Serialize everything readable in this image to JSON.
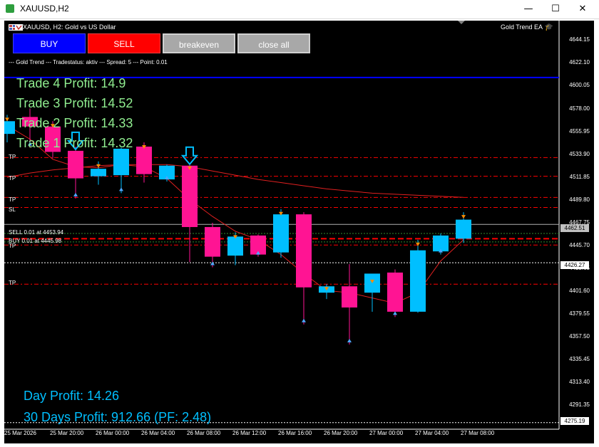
{
  "window": {
    "title": "XAUUSD,H2"
  },
  "chart": {
    "symbol_label": "XAUUSD, H2:  Gold vs US Dollar",
    "ea_label": "Gold Trend EA",
    "status_line": "--- Gold Trend --- Tradestatus: aktiv --- Spread: 5 --- Point: 0.01"
  },
  "buttons": {
    "buy": "BUY",
    "sell": "SELL",
    "breakeven": "breakeven",
    "close_all": "close all"
  },
  "trades": [
    "Trade 4 Profit: 14.9",
    "Trade 3 Profit: 14.52",
    "Trade 2 Profit: 14.33",
    "Trade 1 Profit: 14.32"
  ],
  "profits": {
    "day": "Day Profit: 14.26",
    "month": "30 Days Profit: 912.66 (PF: 2.48)"
  },
  "line_labels": {
    "tp": "TP",
    "sl": "SL",
    "sell_order": "SELL 0.01 at 4453.94",
    "buy_order": "BUY 0.01 at 4445.98"
  },
  "price_boxes": {
    "current": "4462.51",
    "lower": "4426.27",
    "bottom": "4275.19"
  },
  "y_ticks": [
    "4644.15",
    "4622.10",
    "4600.05",
    "4578.00",
    "4555.95",
    "4533.90",
    "4511.85",
    "4489.80",
    "4467.75",
    "4445.70",
    "4423.65",
    "4401.60",
    "4379.55",
    "4357.50",
    "4335.45",
    "4313.40",
    "4291.35"
  ],
  "x_ticks": [
    "25 Mar 2026",
    "25 Mar 20:00",
    "26 Mar 00:00",
    "26 Mar 04:00",
    "26 Mar 08:00",
    "26 Mar 12:00",
    "26 Mar 16:00",
    "26 Mar 20:00",
    "27 Mar 00:00",
    "27 Mar 04:00",
    "27 Mar 08:00"
  ],
  "colors": {
    "bull": "#00bfff",
    "bear": "#ff1493",
    "blue_line": "#0000ff",
    "red_line": "#ff0000",
    "ma": "#e02020"
  },
  "chart_data": {
    "type": "candlestick",
    "candles": [
      {
        "o": 4548,
        "h": 4566,
        "l": 4540,
        "c": 4560
      },
      {
        "o": 4564,
        "h": 4572,
        "l": 4535,
        "c": 4555
      },
      {
        "o": 4555,
        "h": 4560,
        "l": 4525,
        "c": 4531
      },
      {
        "o": 4532,
        "h": 4536,
        "l": 4487,
        "c": 4506
      },
      {
        "o": 4508,
        "h": 4522,
        "l": 4500,
        "c": 4515
      },
      {
        "o": 4509,
        "h": 4535,
        "l": 4492,
        "c": 4534
      },
      {
        "o": 4536,
        "h": 4540,
        "l": 4502,
        "c": 4510
      },
      {
        "o": 4505,
        "h": 4519,
        "l": 4503,
        "c": 4518
      },
      {
        "o": 4518,
        "h": 4520,
        "l": 4427,
        "c": 4460
      },
      {
        "o": 4460,
        "h": 4464,
        "l": 4422,
        "c": 4432
      },
      {
        "o": 4433,
        "h": 4455,
        "l": 4424,
        "c": 4451
      },
      {
        "o": 4452,
        "h": 4453,
        "l": 4432,
        "c": 4434
      },
      {
        "o": 4436,
        "h": 4477,
        "l": 4431,
        "c": 4472
      },
      {
        "o": 4472,
        "h": 4474,
        "l": 4368,
        "c": 4403
      },
      {
        "o": 4398,
        "h": 4406,
        "l": 4392,
        "c": 4404
      },
      {
        "o": 4404,
        "h": 4425,
        "l": 4349,
        "c": 4384
      },
      {
        "o": 4398,
        "h": 4413,
        "l": 4380,
        "c": 4416
      },
      {
        "o": 4417,
        "h": 4420,
        "l": 4375,
        "c": 4380
      },
      {
        "o": 4380,
        "h": 4448,
        "l": 4379,
        "c": 4438
      },
      {
        "o": 4437,
        "h": 4454,
        "l": 4434,
        "c": 4452
      },
      {
        "o": 4449,
        "h": 4474,
        "l": 4445,
        "c": 4467
      }
    ],
    "y_range": [
      4269,
      4655
    ],
    "h_lines": [
      {
        "price": 4601.3,
        "kind": "blue"
      },
      {
        "price": 4525.6,
        "kind": "red-dashdot",
        "label": "TP"
      },
      {
        "price": 4508.0,
        "kind": "red-dashdot",
        "label": "TP"
      },
      {
        "price": 4488.0,
        "kind": "red-dashdot",
        "label": "TP"
      },
      {
        "price": 4478.5,
        "kind": "red-dashdot",
        "label": "SL"
      },
      {
        "price": 4462.51,
        "kind": "gray"
      },
      {
        "price": 4453.94,
        "kind": "green-dotted",
        "label": "SELL 0.01 at 4453.94"
      },
      {
        "price": 4449.0,
        "kind": "red-dashed-bold"
      },
      {
        "price": 4445.98,
        "kind": "green-dotted",
        "label": "BUY 0.01 at 4445.98"
      },
      {
        "price": 4443.0,
        "kind": "red-dashdot",
        "label": "TP"
      },
      {
        "price": 4426.27,
        "kind": "white-dotted"
      },
      {
        "price": 4406.0,
        "kind": "red-dashdot",
        "label": "TP"
      },
      {
        "price": 4275.19,
        "kind": "white-dotted"
      }
    ],
    "ma_slow": [
      4507,
      4511,
      4514,
      4516,
      4518,
      4519,
      4519,
      4519,
      4517,
      4513,
      4509,
      4505,
      4502,
      4499,
      4496,
      4494,
      4492,
      4491,
      4490,
      4489,
      4488
    ],
    "ma_fast": [
      4556,
      4543,
      4524,
      4517,
      4516,
      4519,
      4517,
      4506,
      4486,
      4470,
      4456,
      4448,
      4434,
      4416,
      4400,
      4398,
      4393,
      4388,
      4398,
      4428,
      4448
    ],
    "sell_arrows": [
      3,
      8
    ]
  }
}
